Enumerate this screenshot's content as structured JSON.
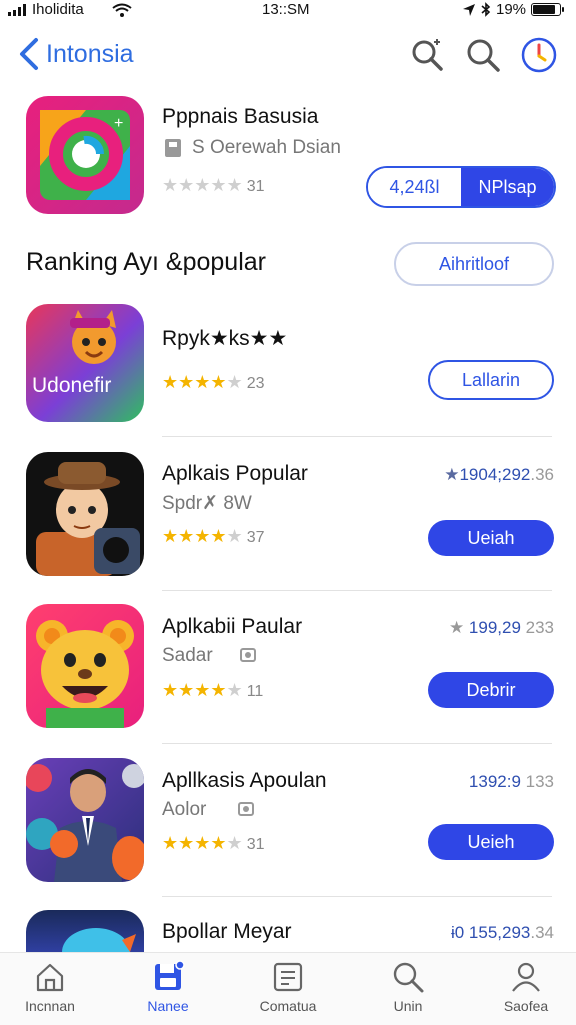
{
  "status": {
    "carrier": "Iholidita",
    "time": "13::SM",
    "battery": "19%"
  },
  "nav": {
    "title": "Intonsia"
  },
  "featured": {
    "title": "Pppnais Basusia",
    "subtitle": "S  Oerewah Dsian",
    "rating_count": "31",
    "price": "4,24ßl",
    "action": "NPlsap"
  },
  "section": {
    "title": "Ranking Ayı &popular",
    "button": "Aihritloof"
  },
  "apps": [
    {
      "title": "Rpyk★ks★★",
      "subtitle": "",
      "rating_count": "23",
      "price": "",
      "price_extra": "",
      "button": "Lallarin",
      "button_style": "outline",
      "icon_text": "Udonefir"
    },
    {
      "title": "Aplkais Popular",
      "subtitle": "Spdr✗ 8W",
      "rating_count": "37",
      "price": "1904;292",
      "price_extra": ".36",
      "button": "Ueiah",
      "button_style": "filled"
    },
    {
      "title": "Aplkabii Paular",
      "subtitle": "Sadar",
      "rating_count": "11",
      "price": "199,29",
      "price_extra": " 233",
      "button": "Debrir",
      "button_style": "filled"
    },
    {
      "title": "Apllkasis Apoulan",
      "subtitle": "Aolor",
      "rating_count": "31",
      "price": "1392:9",
      "price_extra": " 133",
      "button": "Ueieh",
      "button_style": "filled"
    },
    {
      "title": "Bpollar Meyar",
      "subtitle": "",
      "rating_count": "",
      "price": "ɨ0 155,293",
      "price_extra": ".34",
      "button": "",
      "button_style": ""
    }
  ],
  "tabs": [
    {
      "label": "Incnnan",
      "icon": "home-icon"
    },
    {
      "label": "Nanee",
      "icon": "save-icon"
    },
    {
      "label": "Comatua",
      "icon": "document-icon"
    },
    {
      "label": "Unin",
      "icon": "search-icon"
    },
    {
      "label": "Saofea",
      "icon": "person-icon"
    }
  ],
  "colors": {
    "accent": "#2f55e4",
    "accent_fill": "#2f46e6",
    "star": "#f4b400",
    "nav_title": "#2f6de0"
  }
}
